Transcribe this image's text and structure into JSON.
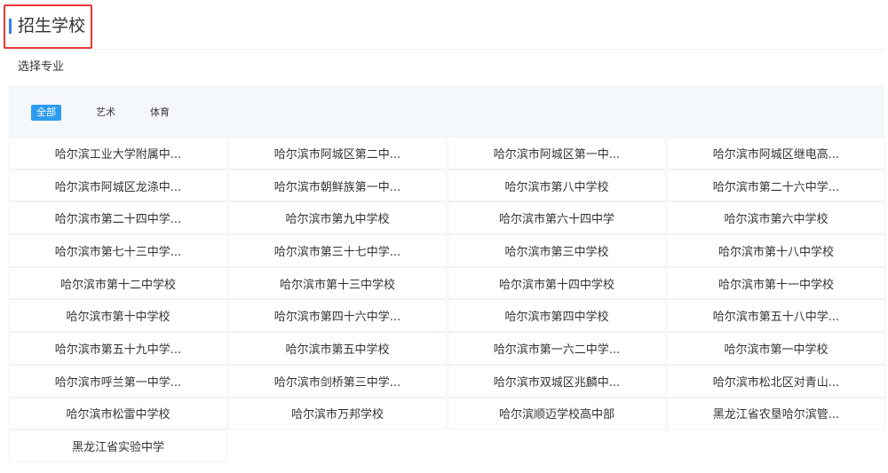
{
  "header": {
    "title": "招生学校",
    "accent_color": "#2f80ed",
    "highlight_color": "#e53935"
  },
  "filter": {
    "label": "选择专业",
    "tabs": [
      {
        "label": "全部",
        "active": true
      },
      {
        "label": "艺术",
        "active": false
      },
      {
        "label": "体育",
        "active": false
      }
    ],
    "active_color": "#2d9cf0"
  },
  "schools": [
    [
      "哈尔滨工业大学附属中...",
      "哈尔滨市阿城区第二中...",
      "哈尔滨市阿城区第一中...",
      "哈尔滨市阿城区继电高..."
    ],
    [
      "哈尔滨市阿城区龙涤中...",
      "哈尔滨市朝鲜族第一中...",
      "哈尔滨市第八中学校",
      "哈尔滨市第二十六中学..."
    ],
    [
      "哈尔滨市第二十四中学...",
      "哈尔滨市第九中学校",
      "哈尔滨市第六十四中学",
      "哈尔滨市第六中学校"
    ],
    [
      "哈尔滨市第七十三中学...",
      "哈尔滨市第三十七中学...",
      "哈尔滨市第三中学校",
      "哈尔滨市第十八中学校"
    ],
    [
      "哈尔滨市第十二中学校",
      "哈尔滨市第十三中学校",
      "哈尔滨市第十四中学校",
      "哈尔滨市第十一中学校"
    ],
    [
      "哈尔滨市第十中学校",
      "哈尔滨市第四十六中学...",
      "哈尔滨市第四中学校",
      "哈尔滨市第五十八中学..."
    ],
    [
      "哈尔滨市第五十九中学...",
      "哈尔滨市第五中学校",
      "哈尔滨市第一六二中学...",
      "哈尔滨市第一中学校"
    ],
    [
      "哈尔滨市呼兰第一中学...",
      "哈尔滨市剑桥第三中学...",
      "哈尔滨市双城区兆麟中...",
      "哈尔滨市松北区对青山..."
    ],
    [
      "哈尔滨市松雷中学校",
      "哈尔滨市万邦学校",
      "哈尔滨顺迈学校高中部",
      "黑龙江省农垦哈尔滨管..."
    ],
    [
      "黑龙江省实验中学"
    ]
  ]
}
